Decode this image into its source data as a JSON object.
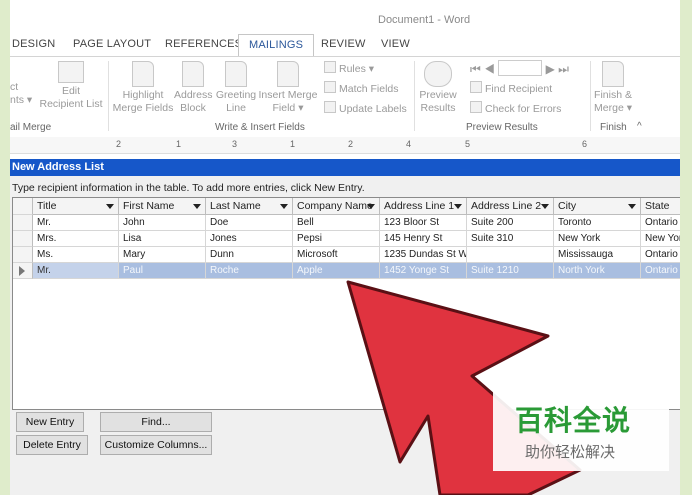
{
  "window": {
    "title": "Document1 - Word"
  },
  "tabs": [
    {
      "label": "DESIGN",
      "active": false
    },
    {
      "label": "PAGE LAYOUT",
      "active": false
    },
    {
      "label": "REFERENCES",
      "active": false
    },
    {
      "label": "MAILINGS",
      "active": true
    },
    {
      "label": "REVIEW",
      "active": false
    },
    {
      "label": "VIEW",
      "active": false
    }
  ],
  "ribbon": {
    "partial_select": "ct",
    "partial_recipients": "nts",
    "edit_recipient_line1": "Edit",
    "edit_recipient_line2": "Recipient List",
    "start_group": "ail Merge",
    "highlight_line1": "Highlight",
    "highlight_line2": "Merge Fields",
    "address_line1": "Address",
    "address_line2": "Block",
    "greeting_line1": "Greeting",
    "greeting_line2": "Line",
    "insert_line1": "Insert Merge",
    "insert_line2": "Field",
    "rules": "Rules",
    "match_fields": "Match Fields",
    "update_labels": "Update Labels",
    "write_group": "Write & Insert Fields",
    "preview_line1": "Preview",
    "preview_line2": "Results",
    "find_recipient": "Find Recipient",
    "check_errors": "Check for Errors",
    "preview_group": "Preview Results",
    "finish_line1": "Finish &",
    "finish_line2": "Merge",
    "finish_group": "Finish",
    "icons": [
      "select-recipients-icon",
      "edit-recipient-list-icon",
      "highlight-merge-fields-icon",
      "address-block-icon",
      "greeting-line-icon",
      "insert-merge-field-icon",
      "rules-icon",
      "match-fields-icon",
      "update-labels-icon",
      "preview-results-icon",
      "find-recipient-icon",
      "check-errors-icon",
      "finish-merge-icon"
    ]
  },
  "ruler": {
    "numbers": [
      "2",
      "1",
      "1",
      "2",
      "3",
      "4",
      "5",
      "6"
    ]
  },
  "dialog": {
    "title": "New Address List",
    "instruction": "Type recipient information in the table.  To add more entries, click New Entry.",
    "columns": [
      "Title",
      "First Name",
      "Last Name",
      "Company Name",
      "Address Line 1",
      "Address Line 2",
      "City",
      "State"
    ],
    "rows": [
      [
        "Mr.",
        "John",
        "Doe",
        "Bell",
        "123 Bloor St",
        "Suite 200",
        "Toronto",
        "Ontario"
      ],
      [
        "Mrs.",
        "Lisa",
        "Jones",
        "Pepsi",
        "145 Henry St",
        "Suite 310",
        "New York",
        "New Yor"
      ],
      [
        "Ms.",
        "Mary",
        "Dunn",
        "Microsoft",
        "1235 Dundas St W",
        "",
        "Mississauga",
        "Ontario"
      ],
      [
        "Mr.",
        "Paul",
        "Roche",
        "Apple",
        "1452 Yonge St",
        "Suite 1210",
        "North York",
        "Ontario"
      ]
    ],
    "selected_row": 3,
    "buttons": {
      "new_entry": "New Entry",
      "find": "Find...",
      "delete_entry": "Delete Entry",
      "customize": "Customize Columns..."
    }
  },
  "colors": {
    "accent_blue": "#2b579a",
    "dialog_title": "#1657c9",
    "arrow_red": "#e0333f",
    "watermark_green": "#2a9a36"
  },
  "watermark": {
    "main": "百科全说",
    "sub": "助你轻松解决"
  }
}
